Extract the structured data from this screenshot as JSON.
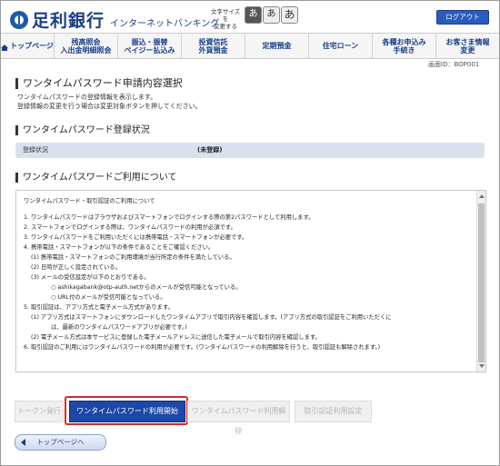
{
  "header": {
    "bank_name": "足利銀行",
    "service_name": "インターネットバンキング",
    "font_size_label_1": "文字サイズを",
    "font_size_label_2": "変更する",
    "font_small": "あ",
    "font_medium": "あ",
    "font_large": "あ",
    "logout": "ログアウト"
  },
  "nav": {
    "home": "トップページ",
    "balance_1": "残高照会",
    "balance_2": "入出金明細照会",
    "transfer_1": "振込・振替",
    "transfer_2": "ペイジー払込み",
    "trust_1": "投資信託",
    "trust_2": "外貨預金",
    "fixed": "定期預金",
    "loan": "住宅ローン",
    "apply_1": "各種お申込み",
    "apply_2": "手続き",
    "customer_1": "お客さま情報",
    "customer_2": "変更"
  },
  "screen_id": "画面ID：BOP001",
  "page": {
    "title": "ワンタイムパスワード申請内容選択",
    "desc_1": "ワンタイムパスワードの登録情報を表示します。",
    "desc_2": "登録情報の変更を行う場合は変更対象ボタンを押してください。"
  },
  "status_section": {
    "heading": "ワンタイムパスワード登録状況",
    "label": "登録状況",
    "value": "(未登録)"
  },
  "terms_section": {
    "heading": "ワンタイムパスワードご利用について",
    "lines": [
      "ワンタイムパスワード・取引認証のご利用について",
      "1. ワンタイムパスワードはブラウザおよびスマートフォンでログインする際の第2パスワードとして利用します。",
      "2. スマートフォンでログインする際は、ワンタイムパスワードの利用が必須です。",
      "3. ワンタイムパスワードをご利用いただくには携帯電話・スマートフォンが必要です。",
      "4. 携帯電話・スマートフォンが以下の条件であることをご確認ください。",
      "(1) 携帯電話・スマートフォンのご利用環境が当行所定の条件を満たしている。",
      "(2) 日時が正しく設定されている。",
      "(3) メールの受信設定が以下のとおりである。",
      "○ ashikagabank@otp-auth.netからのメールが受信可能となっている。",
      "○ URL付のメールが受信可能となっている。",
      "5. 取引認証は、アプリ方式と電子メール方式があります。",
      "(1) アプリ方式はスマートフォンにダウンロードしたワンタイムアプリで取引内容を確認します。(アプリ方式の取引認証をご利用いただくに",
      "は、最新のワンタイムパスワードアプリが必要です。)",
      "(2) 電子メール方式は本サービスに登録した電子メールアドレスに送信した電子メールで取引内容を確認します。",
      "6. 取引認証のご利用にはワンタイムパスワードの利用が必要です。(ワンタイムパスワードの利用解除を行うと、取引認証も解除されます。)"
    ]
  },
  "buttons": {
    "token": "トークン発行",
    "start": "ワンタイムパスワード利用開始",
    "cancel": "ワンタイムパスワード利用解除",
    "auth": "取引認証利用設定",
    "top": "トップページへ"
  }
}
